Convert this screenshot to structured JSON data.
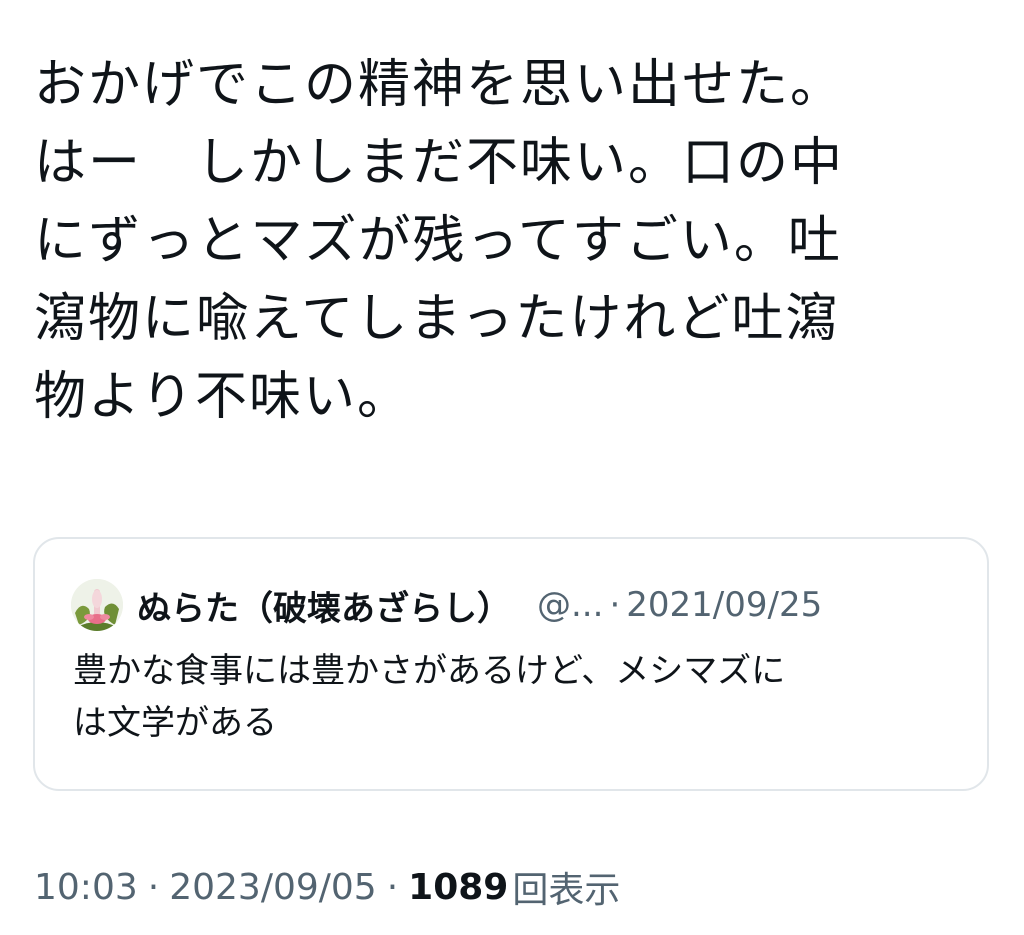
{
  "tweet": {
    "lines": [
      "おかげでこの精神を思い出せた。",
      "はー　しかしまだ不味い。口の中",
      "にずっとマズが残ってすごい。吐",
      "瀉物に喩えてしまったけれど吐瀉",
      "物より不味い。"
    ]
  },
  "quoted_tweet": {
    "author_name": "ぬらた（破壊あざらし）",
    "handle": "@...",
    "separator": "·",
    "date": "2021/09/25",
    "text_lines": [
      "豊かな食事には豊かさがあるけど、メシマズに",
      "は文学がある"
    ],
    "avatar_icon": "flower-avatar"
  },
  "meta": {
    "time": "10:03",
    "separator": "·",
    "date": "2023/09/05",
    "views_count": "1089",
    "views_label": "回表示"
  },
  "colors": {
    "text_primary": "#0f1419",
    "text_secondary": "#536471",
    "card_border": "#e1e6ea"
  }
}
